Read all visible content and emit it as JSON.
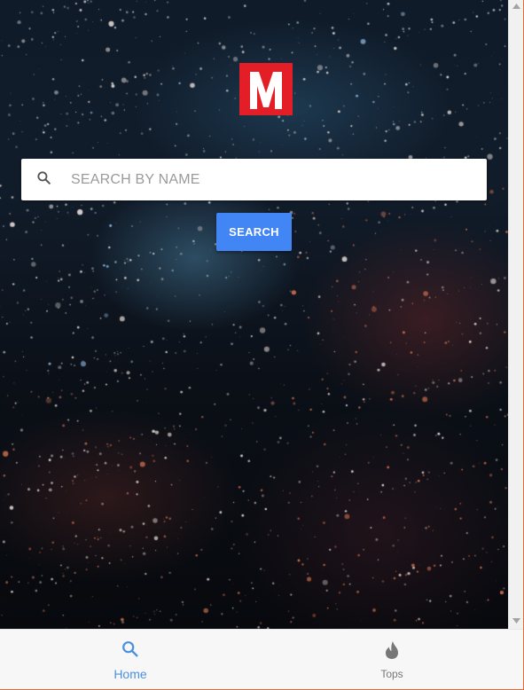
{
  "logo": {
    "letter": "M",
    "color": "#e41e26"
  },
  "search": {
    "placeholder": "SEARCH BY NAME",
    "value": "",
    "button_label": "SEARCH",
    "button_color": "#4285f4",
    "icon": "search-icon"
  },
  "bottom_nav": {
    "items": [
      {
        "label": "Home",
        "icon": "search-icon",
        "active": true,
        "color": "#4a90e2"
      },
      {
        "label": "Tops",
        "icon": "flame-icon",
        "active": false,
        "color": "#777777"
      }
    ]
  }
}
